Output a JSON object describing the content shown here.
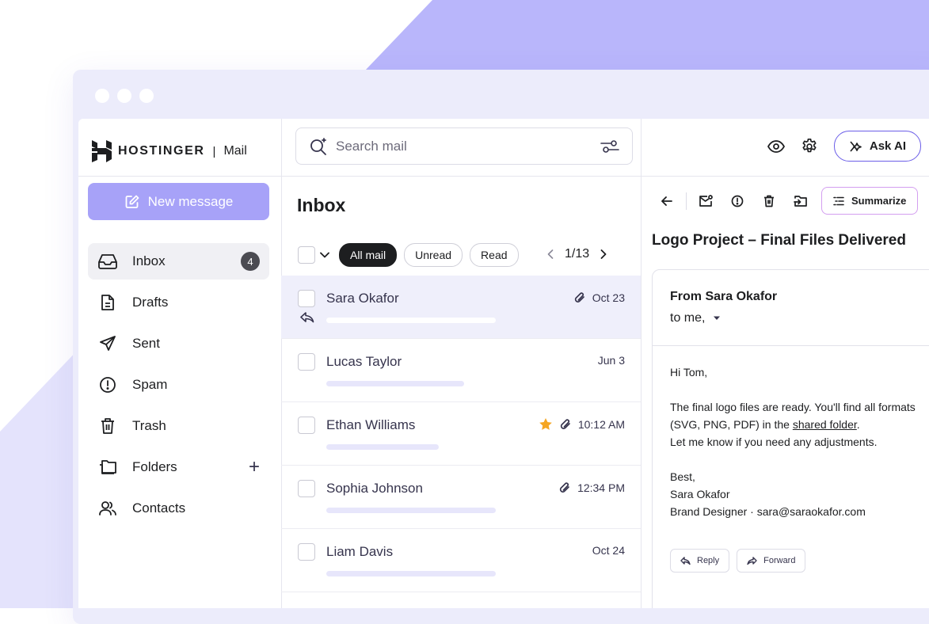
{
  "brand": {
    "name": "HOSTINGER",
    "separator": "|",
    "product": "Mail"
  },
  "compose": {
    "label": "New message"
  },
  "nav": [
    {
      "label": "Inbox",
      "icon": "inbox-icon",
      "badge": "4",
      "active": true
    },
    {
      "label": "Drafts",
      "icon": "drafts-icon"
    },
    {
      "label": "Sent",
      "icon": "send-icon"
    },
    {
      "label": "Spam",
      "icon": "spam-icon"
    },
    {
      "label": "Trash",
      "icon": "trash-icon"
    },
    {
      "label": "Folders",
      "icon": "folder-icon",
      "action": "+"
    },
    {
      "label": "Contacts",
      "icon": "contacts-icon"
    }
  ],
  "search": {
    "placeholder": "Search mail"
  },
  "list": {
    "title": "Inbox",
    "filters": [
      "All mail",
      "Unread",
      "Read"
    ],
    "active_filter": "All mail",
    "page": "1/13",
    "items": [
      {
        "sender": "Sara Okafor",
        "date": "Oct 23",
        "attachment": true,
        "starred": false,
        "selected": true,
        "replied": true
      },
      {
        "sender": "Lucas Taylor",
        "date": "Jun 3",
        "attachment": false,
        "starred": false
      },
      {
        "sender": "Ethan Williams",
        "date": "10:12 AM",
        "attachment": true,
        "starred": true
      },
      {
        "sender": "Sophia Johnson",
        "date": "12:34 PM",
        "attachment": true,
        "starred": false
      },
      {
        "sender": "Liam Davis",
        "date": "Oct 24",
        "attachment": false,
        "starred": false
      }
    ]
  },
  "header_actions": {
    "ask_ai": "Ask AI"
  },
  "reader": {
    "summarize": "Summarize",
    "subject": "Logo Project – Final Files Delivered",
    "from": "From Sara Okafor",
    "to": "to me,",
    "greeting": "Hi Tom,",
    "body_pre": "The final logo files are ready. You'll find all formats (SVG, PNG, PDF) in the ",
    "body_link": "shared folder",
    "body_post": ".",
    "body_line2": "Let me know if you need any adjustments.",
    "signoff": "Best,",
    "sig_name": "Sara Okafor",
    "sig_title": "Brand Designer · sara@saraokafor.com",
    "reply": "Reply",
    "forward": "Forward"
  },
  "colors": {
    "accent": "#a7a2f8",
    "bg_shape": "#b9b6fb",
    "window": "#ececfb",
    "ask_ai_border": "#6b5ee8",
    "star": "#f5a623"
  }
}
